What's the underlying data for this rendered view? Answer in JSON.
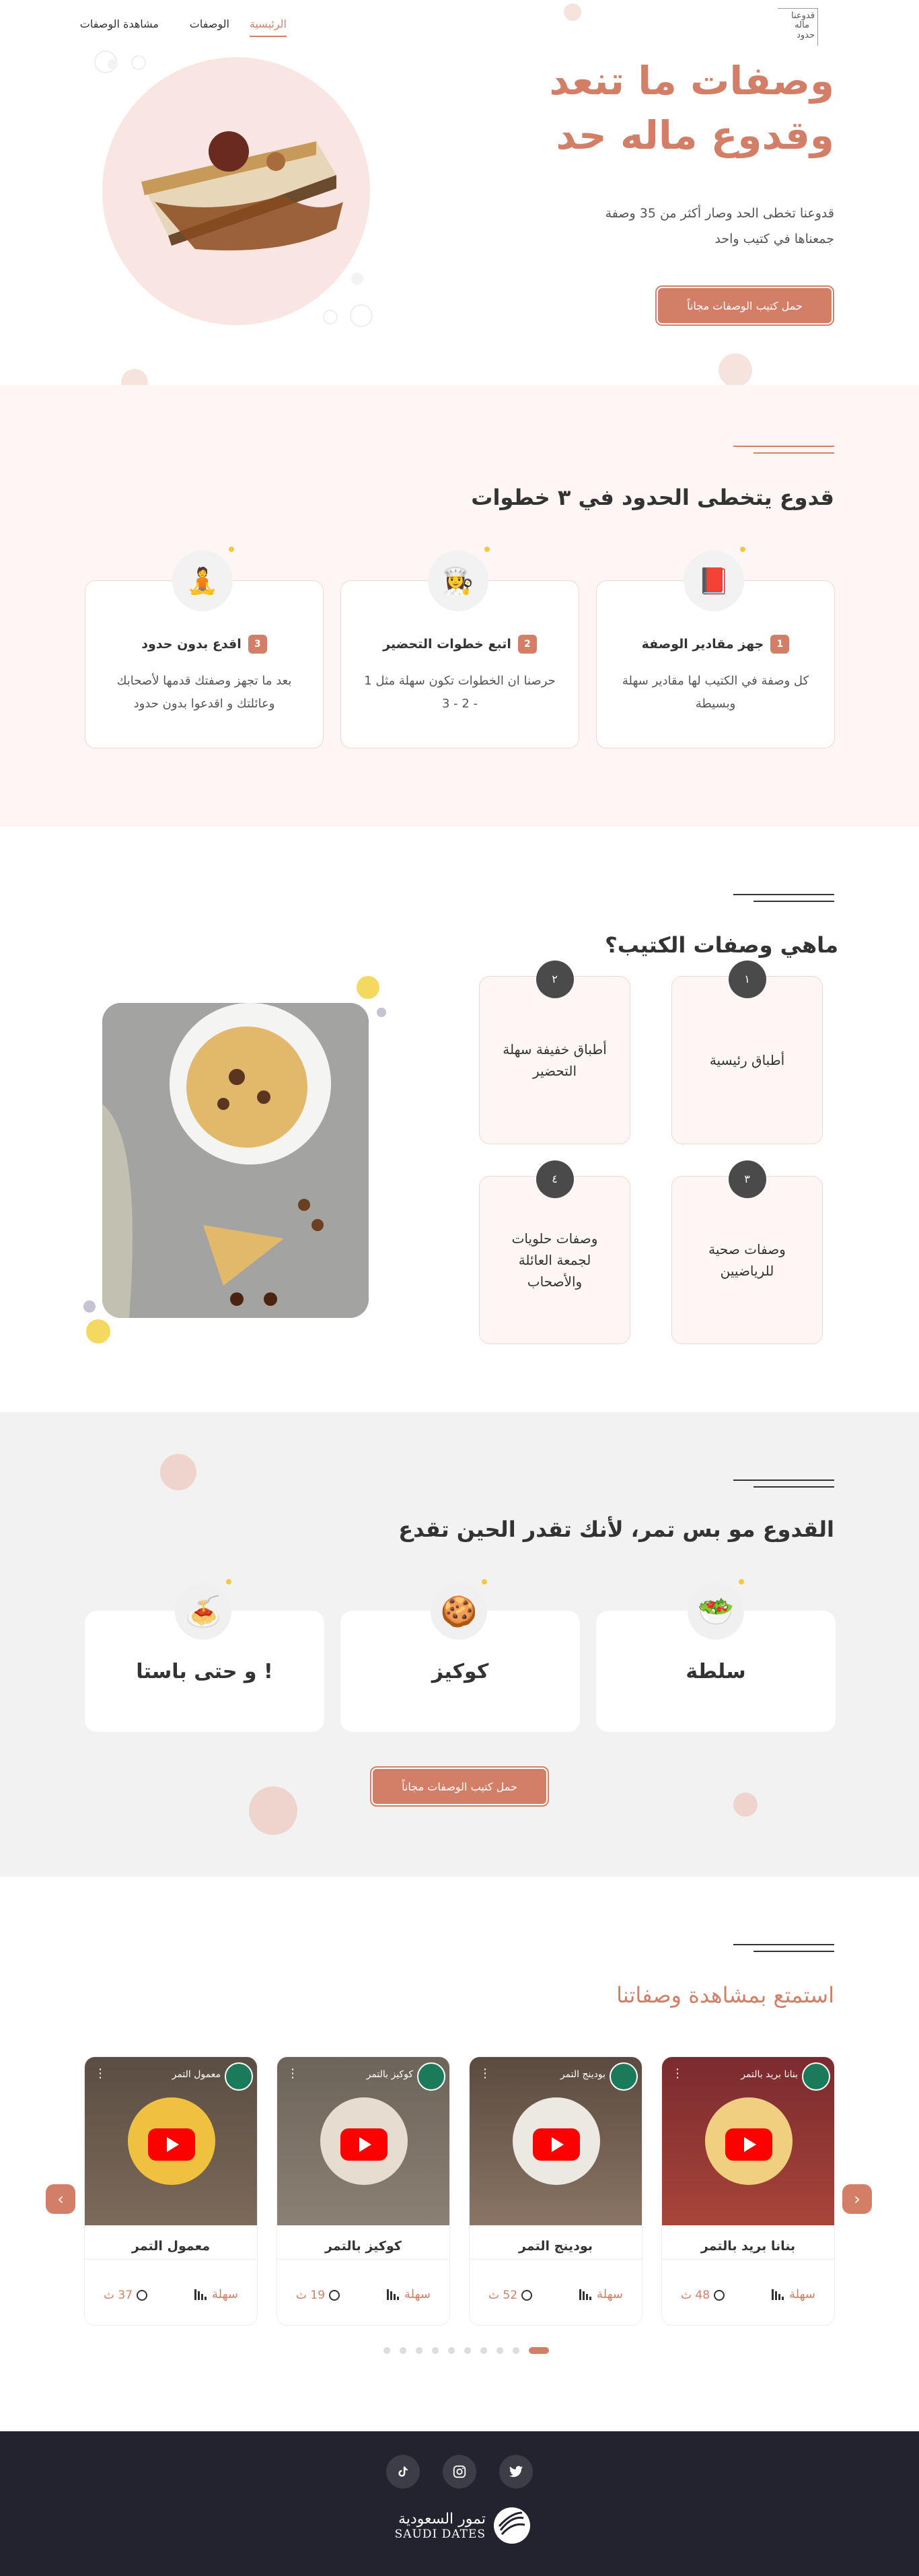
{
  "nav": {
    "items": [
      "الرئيسية",
      "الوصفات",
      "مشاهدة الوصفات"
    ],
    "logo_text": [
      "قدوعنا",
      "ماله",
      "حدود"
    ]
  },
  "hero": {
    "title_line1": "وصفات ما تنعد",
    "title_line2": "وقدوع ماله حد",
    "desc_line1": "قدوعنا تخطى الحد وصار أكثر من 35 وصفة",
    "desc_line2": "جمعناها في كتيب واحد",
    "cta": "حمل كتيب الوصفات مجاناً"
  },
  "steps": {
    "title": "قدوع يتخطى الحدود في ٣ خطوات",
    "items": [
      {
        "num": "1",
        "title": "جهز مقادير الوصفة",
        "desc": "كل وصفة في الكتيب لها مقادير سهلة وبسيطة",
        "icon": "book-icon"
      },
      {
        "num": "2",
        "title": "اتبع خطوات التحضير",
        "desc": "حرصنا ان الخطوات تكون سهلة مثل 1 - 2 - 3",
        "icon": "cooking-icon"
      },
      {
        "num": "3",
        "title": "اقدع بدون حدود",
        "desc": "بعد ما تجهز وصفتك قدمها لأصحابك وعائلتك و اقدعوا بدون حدود",
        "icon": "meditation-icon"
      }
    ]
  },
  "kinds": {
    "title": "ماهي وصفات الكتيب؟",
    "items": [
      {
        "num": "١",
        "label": "أطباق رئيسية"
      },
      {
        "num": "٢",
        "label": "أطباق خفيفة سهلة التحضير"
      },
      {
        "num": "٣",
        "label": "وصفات صحية للرياضيين"
      },
      {
        "num": "٤",
        "label": "وصفات حلويات لجمعة العائلة والأصحاب"
      }
    ]
  },
  "foods": {
    "title": "القدوع مو بس تمر، لأنك تقدر الحين تقدع",
    "items": [
      {
        "label": "سلطة",
        "icon": "salad-icon"
      },
      {
        "label": "كوكيز",
        "icon": "cookie-icon"
      },
      {
        "label": "! و حتى باستا",
        "icon": "pasta-icon"
      }
    ],
    "cta": "حمل كتيب الوصفات مجاناً"
  },
  "videos": {
    "title": "استمتع بمشاهدة وصفاتنا",
    "items": [
      {
        "thumb_title": "بنانا بريد بالتمر",
        "title": "بنانا بريد بالتمر",
        "level": "سهلة",
        "time": "48 ث"
      },
      {
        "thumb_title": "بودينج التمر",
        "title": "بودينج التمر",
        "level": "سهلة",
        "time": "52 ث"
      },
      {
        "thumb_title": "كوكيز بالتمر",
        "title": "كوكيز بالتمر",
        "level": "سهلة",
        "time": "19 ث"
      },
      {
        "thumb_title": "معمول التمر",
        "title": "معمول التمر",
        "level": "سهلة",
        "time": "37 ث"
      }
    ],
    "page_count": 10,
    "active_page": 10
  },
  "footer": {
    "social": [
      "twitter-icon",
      "instagram-icon",
      "tiktok-icon"
    ],
    "brand_ar": "تمور السعودية",
    "brand_en": "SAUDI DATES"
  },
  "colors": {
    "accent": "#d37f68",
    "footer": "#22232f",
    "pink_bg": "#fdf6f4",
    "gray_bg": "#f2f2f2"
  }
}
